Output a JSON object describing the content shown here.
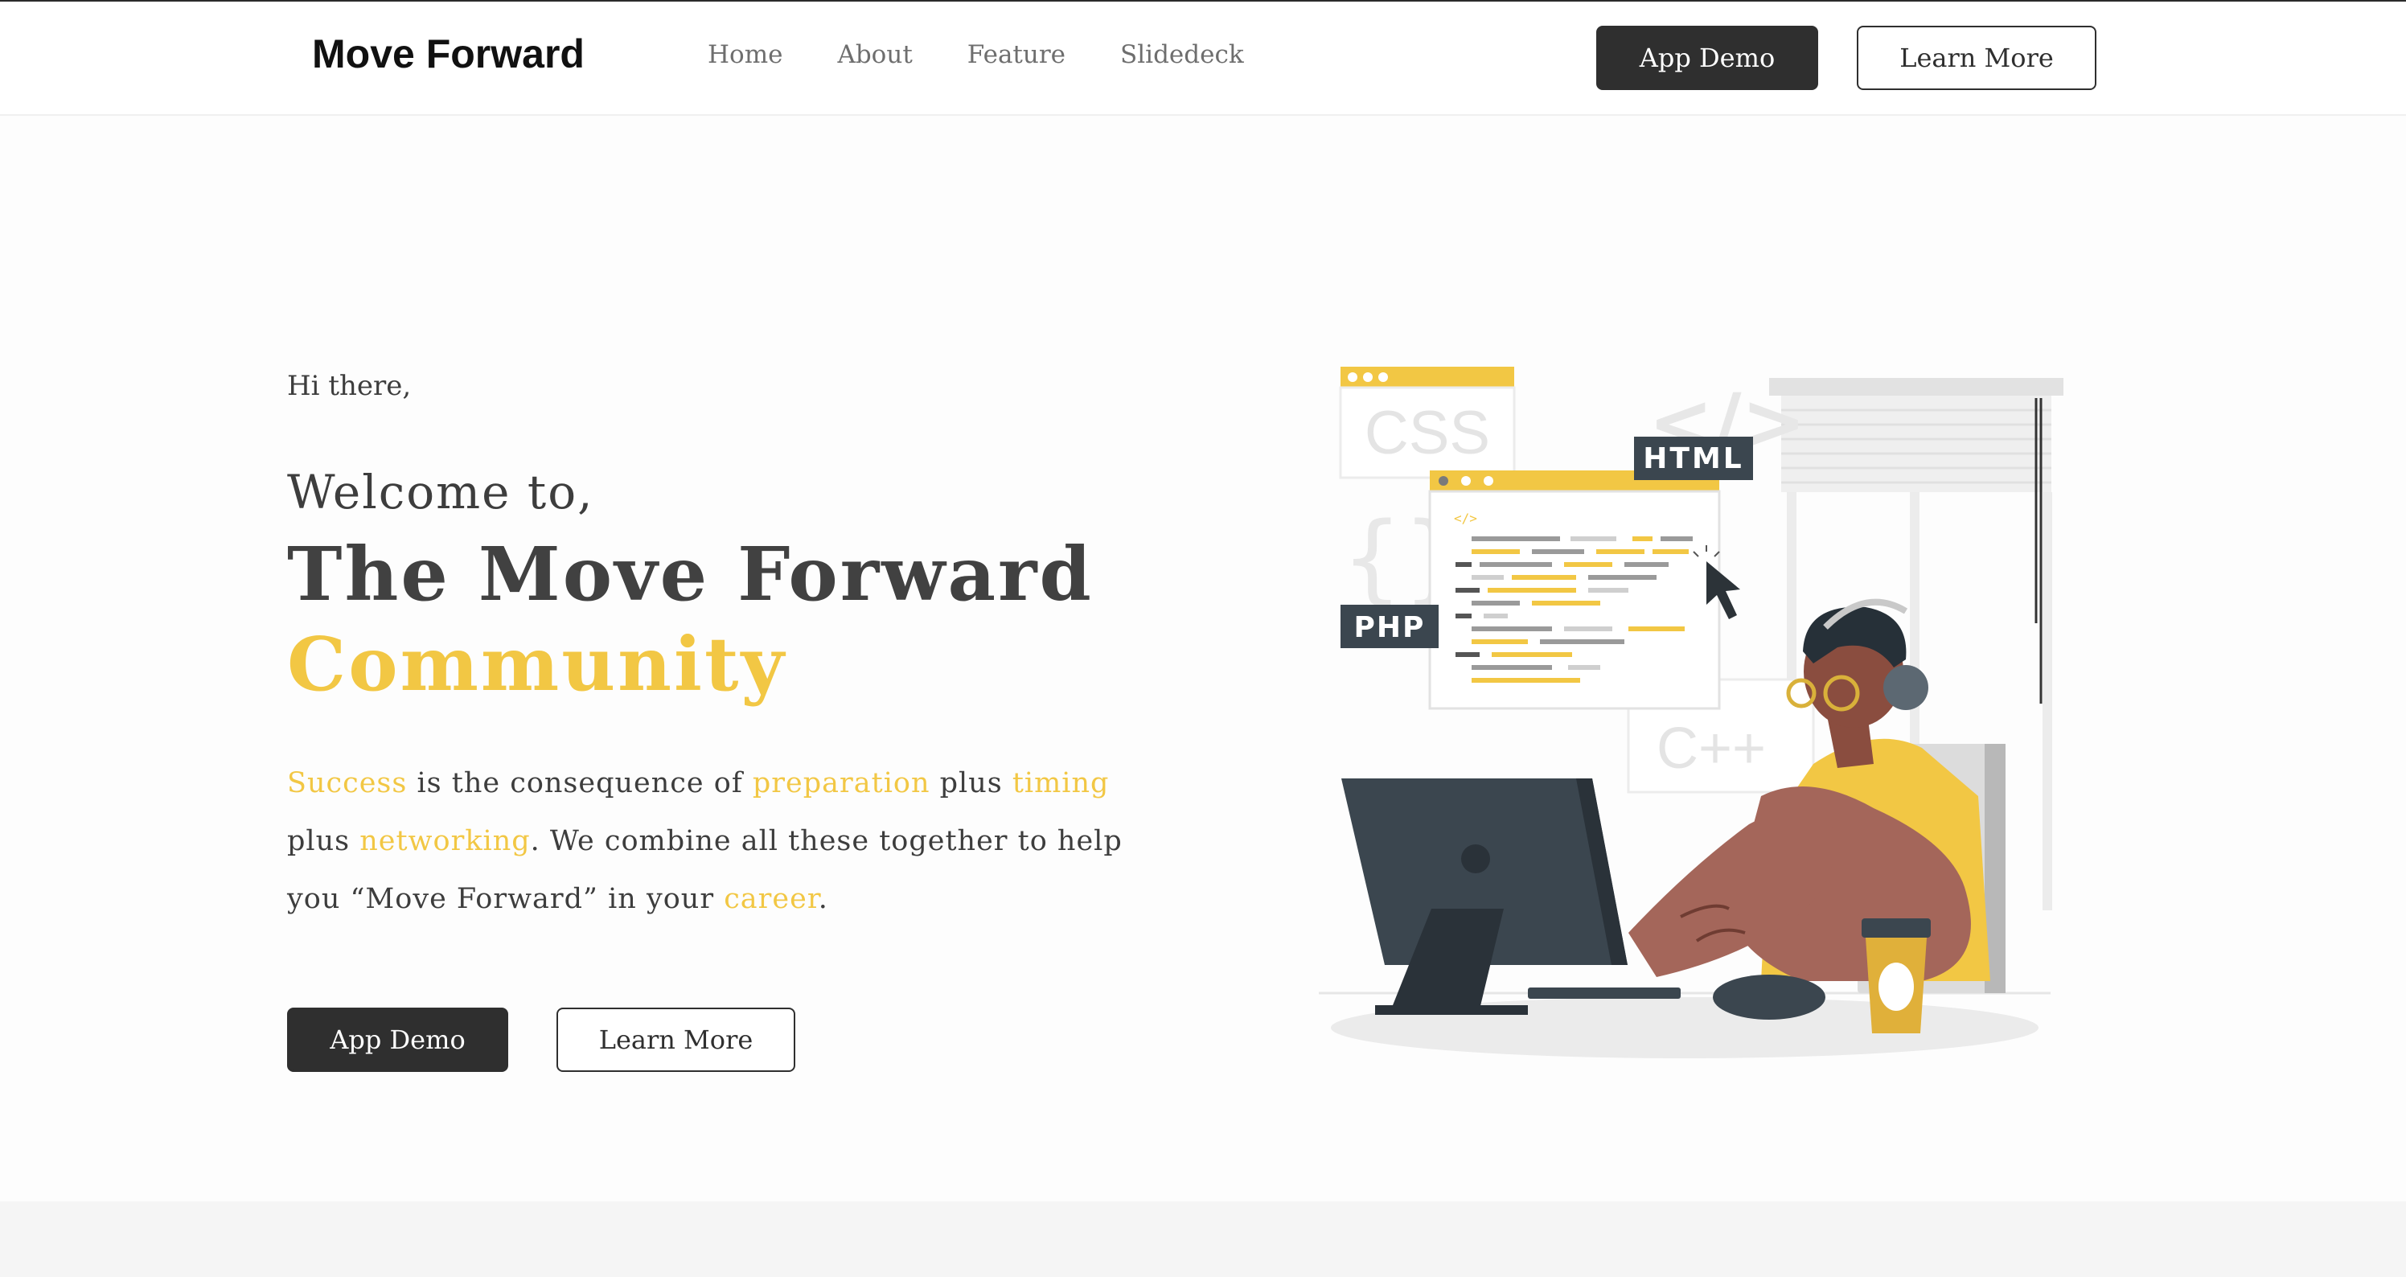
{
  "header": {
    "logo": "Move Forward",
    "nav": [
      "Home",
      "About",
      "Feature",
      "Slidedeck"
    ],
    "app_demo": "App Demo",
    "learn_more": "Learn More"
  },
  "hero": {
    "greeting": "Hi there,",
    "welcome": "Welcome to,",
    "title_line1": "The Move Forward",
    "title_line2": "Community",
    "paragraph": {
      "w_success": "Success",
      "t1": " is the consequence of ",
      "w_preparation": "preparation",
      "t2": " plus ",
      "w_timing": "timing",
      "t3": " plus ",
      "w_networking": "networking",
      "t4": ". We combine all these together to help you “Move Forward” in your ",
      "w_career": "career",
      "t5": "."
    },
    "app_demo": "App Demo",
    "learn_more": "Learn More"
  },
  "illustration": {
    "labels": {
      "css": "CSS",
      "html": "HTML",
      "php": "PHP",
      "cpp": "C++",
      "html_tag": "</>",
      "braces": "{}"
    }
  },
  "colors": {
    "accent": "#f2c744",
    "dark": "#2f2f2f",
    "slate": "#3b464f"
  }
}
